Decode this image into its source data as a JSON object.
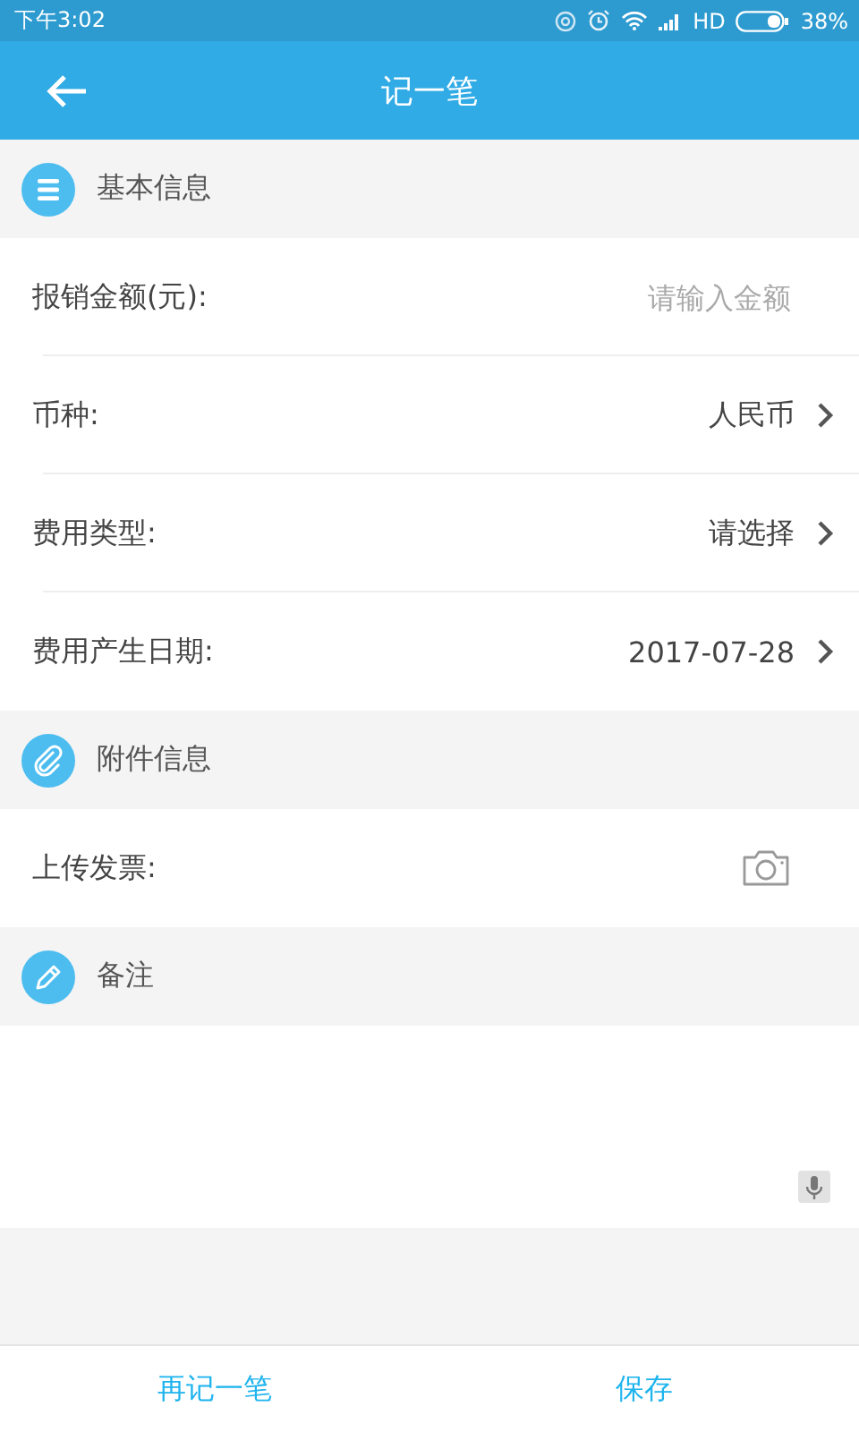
{
  "status_bar": {
    "time": "下午3:02",
    "network": "HD",
    "battery": "38%"
  },
  "header": {
    "title": "记一笔"
  },
  "sections": [
    {
      "title": "基本信息",
      "rows": [
        {
          "kind": "input",
          "label": "报销金额(元):",
          "placeholder": "请输入金额"
        },
        {
          "kind": "select",
          "label": "币种:",
          "value": "人民币"
        },
        {
          "kind": "select",
          "label": "费用类型:",
          "value": "请选择"
        },
        {
          "kind": "select",
          "label": "费用产生日期:",
          "value": "2017-07-28"
        }
      ]
    },
    {
      "title": "附件信息",
      "rows": [
        {
          "kind": "upload",
          "label": "上传发票:"
        }
      ]
    },
    {
      "title": "备注",
      "rows": [
        {
          "kind": "textarea"
        }
      ]
    }
  ],
  "buttons": [
    "再记一笔",
    "保存"
  ]
}
